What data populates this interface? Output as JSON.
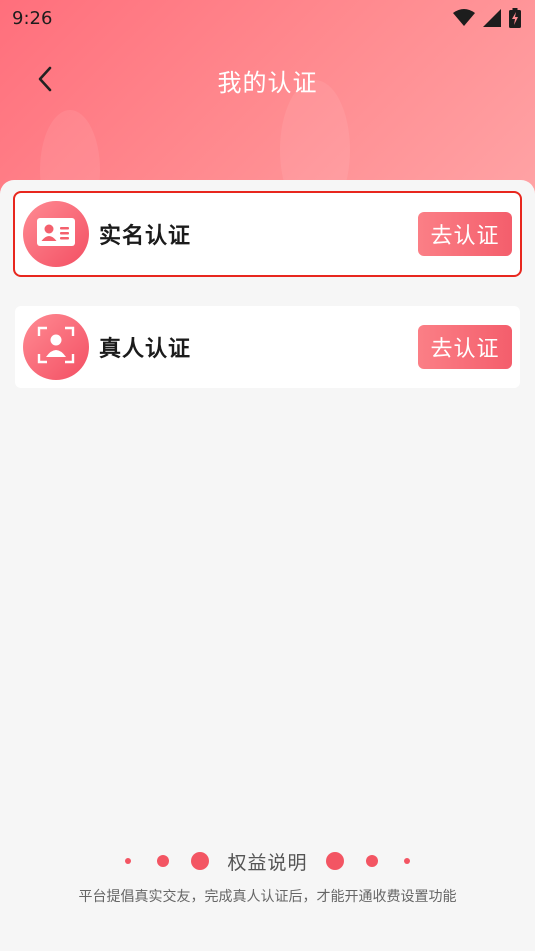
{
  "status_bar": {
    "time": "9:26",
    "icons": [
      "wifi-icon",
      "signal-icon",
      "battery-charging-icon"
    ]
  },
  "nav": {
    "title": "我的认证",
    "back_icon": "chevron-left-icon"
  },
  "cards": [
    {
      "label": "实名认证",
      "button": "去认证",
      "icon": "id-card-icon",
      "selected": true
    },
    {
      "label": "真人认证",
      "button": "去认证",
      "icon": "face-scan-icon",
      "selected": false
    }
  ],
  "benefits": {
    "title": "权益说明",
    "note": "平台提倡真实交友，完成真人认证后，才能开通收费设置功能"
  },
  "colors": {
    "accent": "#f35563",
    "header_gradient_start": "#ff6f7c",
    "header_gradient_end": "#ffa3a5",
    "selection_outline": "#e8271e"
  }
}
